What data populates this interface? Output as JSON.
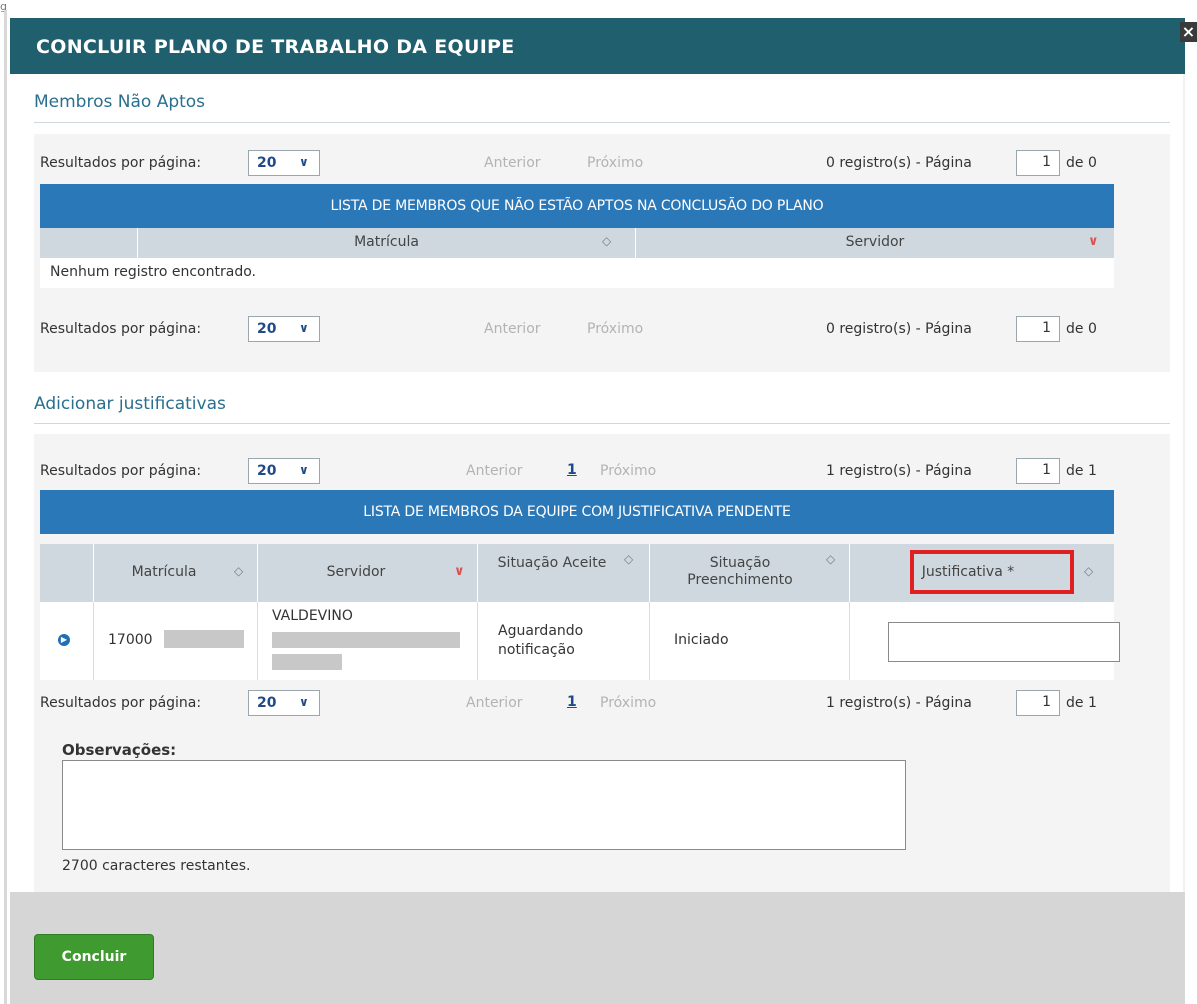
{
  "dialog": {
    "title": "CONCLUIR PLANO DE TRABALHO DA EQUIPE",
    "close_glyph": "×"
  },
  "top_left_glyph": "g",
  "pager_common": {
    "label": "Resultados por página:",
    "per_page": "20",
    "prev": "Anterior",
    "next": "Próximo",
    "page_word": "de"
  },
  "nao_aptos": {
    "section_title": "Membros Não Aptos",
    "pager": {
      "info": "0 registro(s) - Página",
      "page": "1",
      "total": "de 0"
    },
    "table_title": "LISTA DE MEMBROS QUE NÃO ESTÃO APTOS NA CONCLUSÃO DO PLANO",
    "columns": [
      "Matrícula",
      "Servidor"
    ],
    "empty_text": "Nenhum registro encontrado."
  },
  "justificativas": {
    "section_title": "Adicionar justificativas",
    "pager": {
      "info": "1 registro(s) - Página",
      "page": "1",
      "total": "de 1",
      "current": "1"
    },
    "table_title": "LISTA DE MEMBROS DA EQUIPE COM JUSTIFICATIVA PENDENTE",
    "columns": [
      "Matrícula",
      "Servidor",
      "Situação Aceite",
      "Situação Preenchimento",
      "Justificativa *"
    ],
    "rows": [
      {
        "matricula": "17000",
        "servidor": "VALDEVINO",
        "situacao_aceite": "Aguardando notificação",
        "situacao_preenchimento": "Iniciado",
        "justificativa": ""
      }
    ]
  },
  "observacoes": {
    "label": "Observações:",
    "value": "",
    "remaining": "2700 caracteres restantes."
  },
  "footer": {
    "submit_label": "Concluir"
  },
  "icons": {
    "dropdown": "chevron-down-icon",
    "sort": "sort-icon",
    "sort_desc": "sort-desc-icon",
    "expand": "expand-row-icon"
  },
  "colors": {
    "titlebar": "#1f5f6e",
    "table_header": "#2b78b9",
    "submit": "#3f9b2f",
    "highlight": "#e02020"
  }
}
